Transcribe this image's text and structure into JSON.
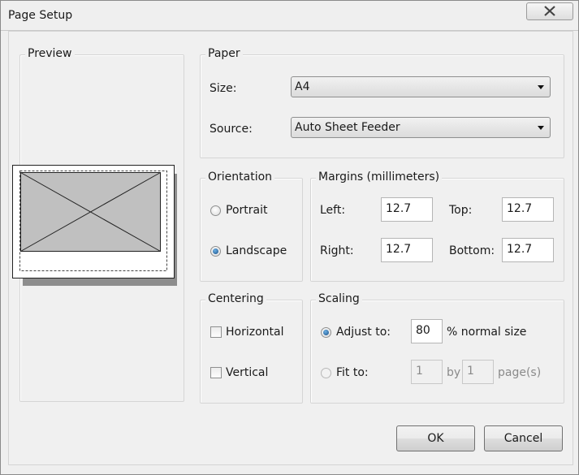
{
  "window": {
    "title": "Page Setup"
  },
  "preview": {
    "label": "Preview"
  },
  "paper": {
    "label": "Paper",
    "size_label": "Size:",
    "size_value": "A4",
    "source_label": "Source:",
    "source_value": "Auto Sheet Feeder"
  },
  "orientation": {
    "label": "Orientation",
    "options": [
      "Portrait",
      "Landscape"
    ],
    "selected": "Landscape"
  },
  "margins": {
    "label": "Margins (millimeters)",
    "left_label": "Left:",
    "left_value": "12.7",
    "top_label": "Top:",
    "top_value": "12.7",
    "right_label": "Right:",
    "right_value": "12.7",
    "bottom_label": "Bottom:",
    "bottom_value": "12.7"
  },
  "centering": {
    "label": "Centering",
    "horizontal_label": "Horizontal",
    "vertical_label": "Vertical",
    "horizontal_checked": false,
    "vertical_checked": false
  },
  "scaling": {
    "label": "Scaling",
    "adjust_label": "Adjust to:",
    "adjust_value": "80",
    "adjust_suffix": "% normal size",
    "fit_label": "Fit to:",
    "fit_width_value": "1",
    "fit_by_label": "by",
    "fit_height_value": "1",
    "fit_suffix": "page(s)",
    "selected": "adjust"
  },
  "buttons": {
    "ok": "OK",
    "cancel": "Cancel"
  },
  "icons": {
    "close": "close-icon",
    "dropdown": "chevron-down-icon"
  }
}
